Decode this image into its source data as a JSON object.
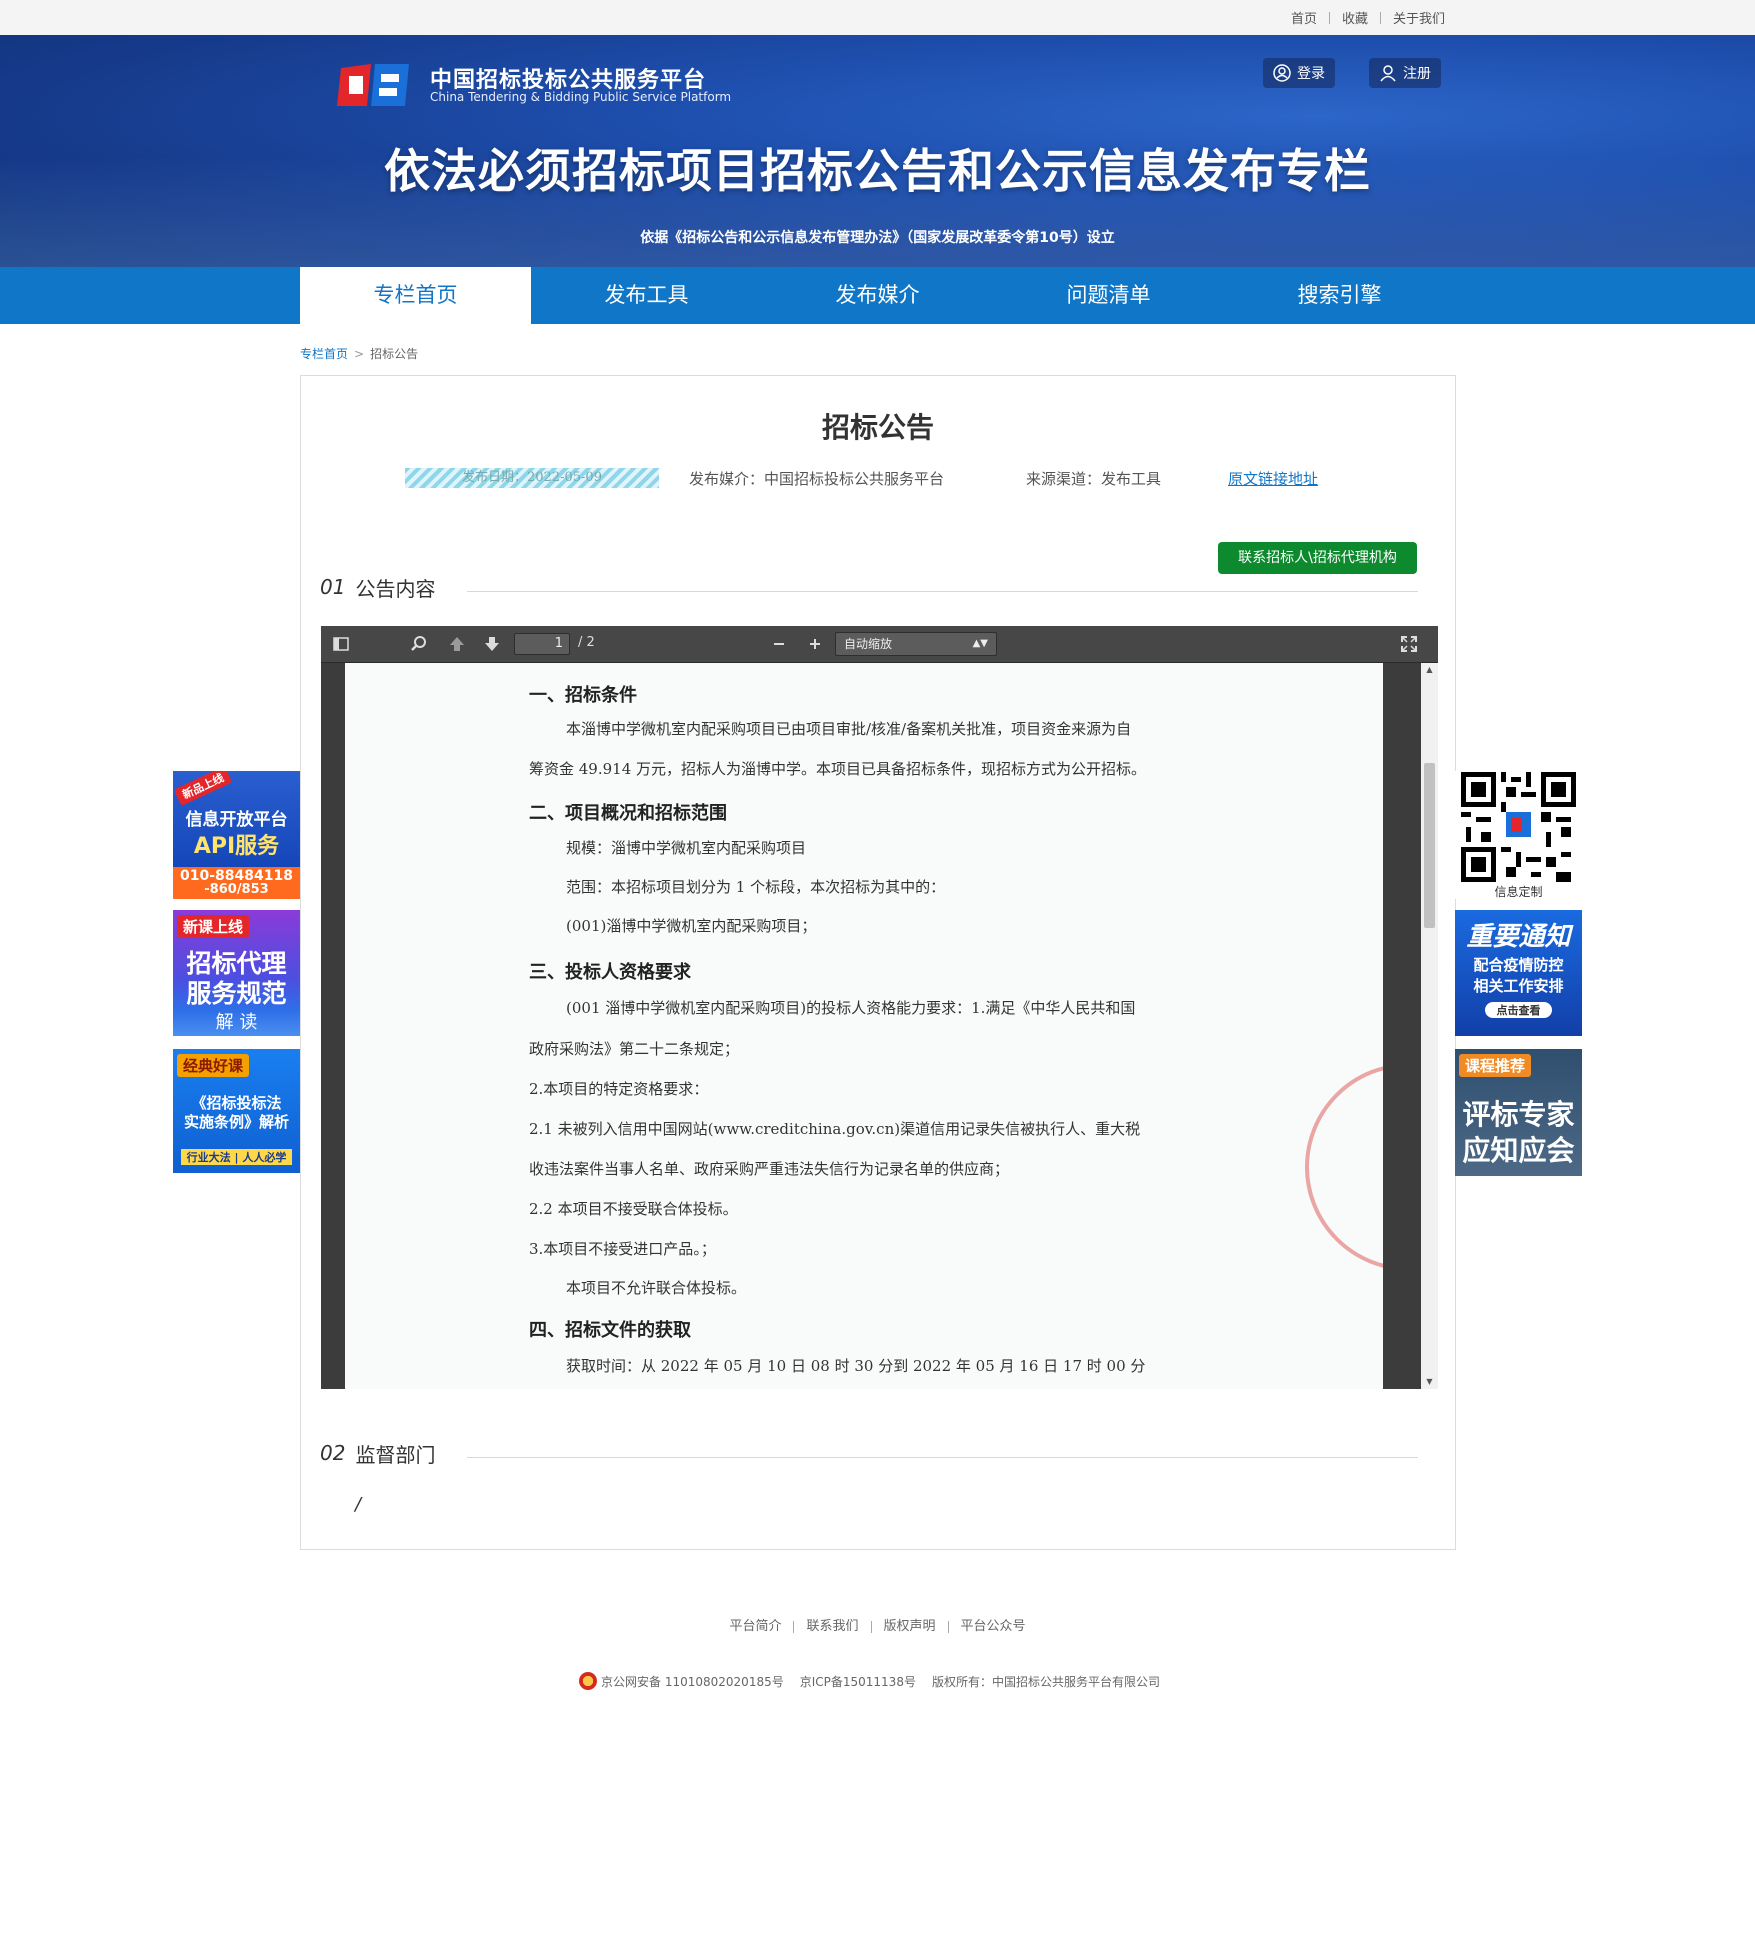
{
  "topbar": {
    "links": [
      "首页",
      "收藏",
      "关于我们"
    ]
  },
  "banner": {
    "logo_cn": "中国招标投标公共服务平台",
    "logo_en": "China Tendering & Bidding Public Service Platform",
    "login": "登录",
    "register": "注册",
    "title": "依法必须招标项目招标公告和公示信息发布专栏",
    "subtitle": "依据《招标公告和公示信息发布管理办法》（国家发展改革委令第10号）设立"
  },
  "nav": {
    "tabs": [
      "专栏首页",
      "发布工具",
      "发布媒介",
      "问题清单",
      "搜索引擎"
    ],
    "active": 0
  },
  "breadcrumb": {
    "home": "专栏首页",
    "current": "招标公告"
  },
  "notice": {
    "title": "招标公告",
    "publish_date": "发布日期：2022-05-09",
    "media": "发布媒介：中国招标投标公共服务平台",
    "source": "来源渠道：发布工具",
    "original_link": "原文链接地址",
    "contact_button": "联系招标人\\招标代理机构"
  },
  "sections": [
    {
      "num": "01",
      "label": "公告内容"
    },
    {
      "num": "02",
      "label": "监督部门"
    }
  ],
  "supervision_value": "/",
  "viewer": {
    "page_current": "1",
    "page_total": "/ 2",
    "zoom": "自动缩放",
    "icons": [
      "sidebar-toggle-icon",
      "search-icon",
      "previous-page-icon",
      "next-page-icon",
      "zoom-out-icon",
      "zoom-in-icon",
      "fullscreen-icon"
    ]
  },
  "pdf": {
    "h1": "一、招标条件",
    "p1a": "本淄博中学微机室内配采购项目已由项目审批/核准/备案机关批准，项目资金来源为自",
    "p1b": "筹资金 49.914 万元，招标人为淄博中学。本项目已具备招标条件，现招标方式为公开招标。",
    "h2": "二、项目概况和招标范围",
    "p2a": "规模：淄博中学微机室内配采购项目",
    "p2b": "范围：本招标项目划分为 1 个标段，本次招标为其中的：",
    "p2c": "(001)淄博中学微机室内配采购项目；",
    "h3": "三、投标人资格要求",
    "p3a": "(001 淄博中学微机室内配采购项目)的投标人资格能力要求：1.满足《中华人民共和国",
    "p3b": "政府采购法》第二十二条规定；",
    "p3c": "2.本项目的特定资格要求：",
    "p3d": "2.1 未被列入信用中国网站(www.creditchina.gov.cn)渠道信用记录失信被执行人、重大税",
    "p3e": "收违法案件当事人名单、政府采购严重违法失信行为记录名单的供应商；",
    "p3f": "2.2 本项目不接受联合体投标。",
    "p3g": "3.本项目不接受进口产品。；",
    "p3h": "本项目不允许联合体投标。",
    "h4": "四、招标文件的获取",
    "p4a": "获取时间：从 2022 年 05 月 10 日 08 时 30 分到 2022 年 05 月 16 日 17 时 00 分"
  },
  "ads_left": [
    {
      "badge": "新品上线",
      "line1": "信息开放平台",
      "line2": "API服务",
      "line3": "010-88484118",
      "line4": "-860/853"
    },
    {
      "badge": "新课上线",
      "line1": "招标代理",
      "line2": "服务规范",
      "line3": "解 读"
    },
    {
      "badge": "经典好课",
      "line1": "《招标投标法",
      "line2": "实施条例》解析",
      "line3": "行业大法 | 人人必学"
    }
  ],
  "ads_right": [
    {
      "caption": "信息定制"
    },
    {
      "line1": "重要通知",
      "line2": "配合疫情防控",
      "line3": "相关工作安排",
      "line4": "点击查看"
    },
    {
      "badge": "课程推荐",
      "line1": "评标专家",
      "line2": "应知应会"
    }
  ],
  "footer": {
    "links": [
      "平台简介",
      "联系我们",
      "版权声明",
      "平台公众号"
    ],
    "police": "京公网安备 11010802020185号",
    "icp": "京ICP备15011138号",
    "copyright": "版权所有：中国招标公共服务平台有限公司"
  },
  "colors": {
    "nav": "#1076c8",
    "green_button": "#0e8a2e",
    "link": "#1076c8"
  }
}
